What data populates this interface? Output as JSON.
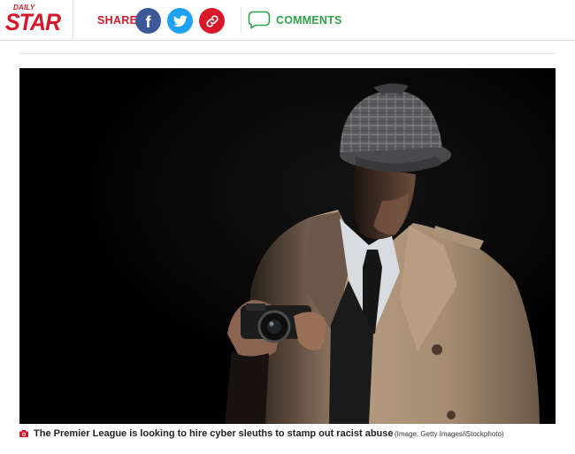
{
  "header": {
    "logo_top": "DAILY",
    "logo_main": "STAR",
    "share_label": "SHARE",
    "share_buttons": [
      {
        "name": "facebook",
        "icon": "facebook-icon",
        "color": "#3b5998"
      },
      {
        "name": "twitter",
        "icon": "twitter-icon",
        "color": "#1da1f2"
      },
      {
        "name": "copy-link",
        "icon": "link-icon",
        "color": "#d8182a"
      }
    ],
    "comments_label": "COMMENTS",
    "colors": {
      "brand": "#d8182a",
      "comments": "#2ea34a"
    }
  },
  "article": {
    "image": {
      "subject": "man in deerstalker hat and trench coat holding a camera in shadow"
    },
    "caption": {
      "icon": "camera-icon",
      "text": "The Premier League is looking to hire cyber sleuths to stamp out racist abuse",
      "credit": "(Image: Getty Images/iStockphoto)"
    }
  }
}
